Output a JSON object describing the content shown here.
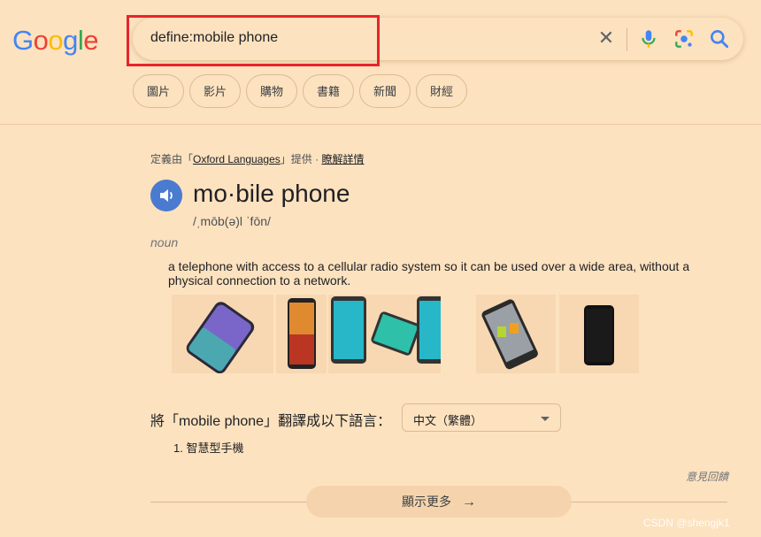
{
  "logo": [
    "G",
    "o",
    "o",
    "g",
    "l",
    "e"
  ],
  "search": {
    "query": "define:mobile phone",
    "clear_icon": "close-icon",
    "mic_icon": "microphone-icon",
    "lens_icon": "google-lens-icon",
    "search_icon": "search-icon"
  },
  "chips": [
    "圖片",
    "影片",
    "購物",
    "書籍",
    "新聞",
    "財經"
  ],
  "dictionary": {
    "source_prefix": "定義由「",
    "source_name": "Oxford Languages",
    "source_suffix": "」提供 · ",
    "learn_more": "瞭解詳情",
    "word": "mo·bile phone",
    "pronunciation": "/ˌmōb(ə)l ˈfōn/",
    "part_of_speech": "noun",
    "definition": "a telephone with access to a cellular radio system so it can be used over a wide area, without a physical connection to a network."
  },
  "translation": {
    "label": "將「mobile phone」翻譯成以下語言：",
    "language": "中文（繁體）",
    "result": "1. 智慧型手機"
  },
  "feedback": "意見回饋",
  "show_more": "顯示更多",
  "watermark": "CSDN @shengjk1",
  "colors": {
    "accent_blue": "#4285f4",
    "highlight_red": "#e8242b",
    "background": "#fde2bf"
  }
}
